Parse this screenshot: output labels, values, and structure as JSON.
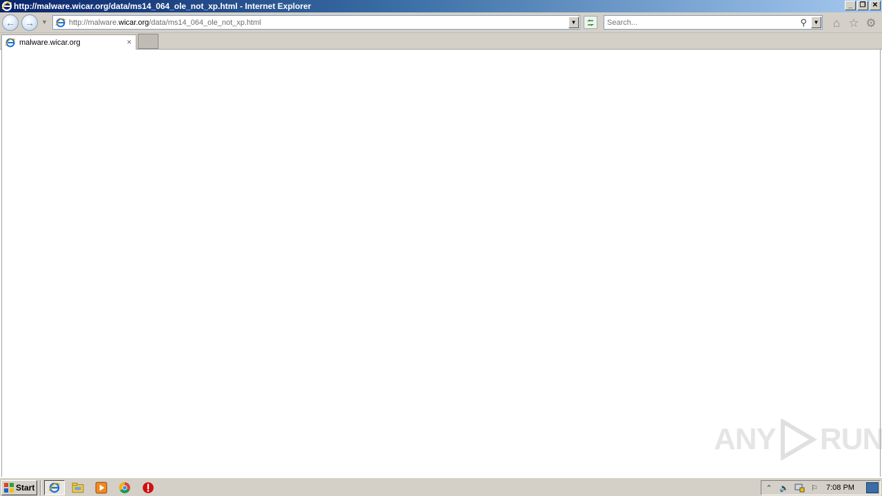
{
  "window": {
    "title": "http://malware.wicar.org/data/ms14_064_ole_not_xp.html - Internet Explorer",
    "minimize_glyph": "_",
    "restore_glyph": "❐",
    "close_glyph": "✕"
  },
  "navbar": {
    "back_glyph": "←",
    "forward_glyph": "→",
    "address_url_prefix": "http://malware.",
    "address_url_domain": "wicar.org",
    "address_url_path": "/data/ms14_064_ole_not_xp.html",
    "search_placeholder": "Search...",
    "icons": [
      "back-icon",
      "forward-icon",
      "ie-page-icon",
      "refresh-icon",
      "search-icon",
      "home-icon",
      "favorites-icon",
      "tools-gear-icon"
    ]
  },
  "tabs": [
    {
      "label": "malware.wicar.org",
      "close_glyph": "×"
    }
  ],
  "watermark": {
    "left": "ANY",
    "right": "RUN"
  },
  "taskbar": {
    "start_label": "Start",
    "apps": [
      "internet-explorer-icon",
      "explorer-folder-icon",
      "media-player-icon",
      "chrome-icon",
      "stop-icon"
    ],
    "clock": "7:08 PM",
    "tray_icons": [
      "show-hidden-icon",
      "volume-icon",
      "network-icon",
      "action-center-flag-icon"
    ]
  },
  "colors": {
    "titlebar_start": "#0a246a",
    "titlebar_end": "#a6caf0",
    "chrome": "#d4d0c8"
  }
}
